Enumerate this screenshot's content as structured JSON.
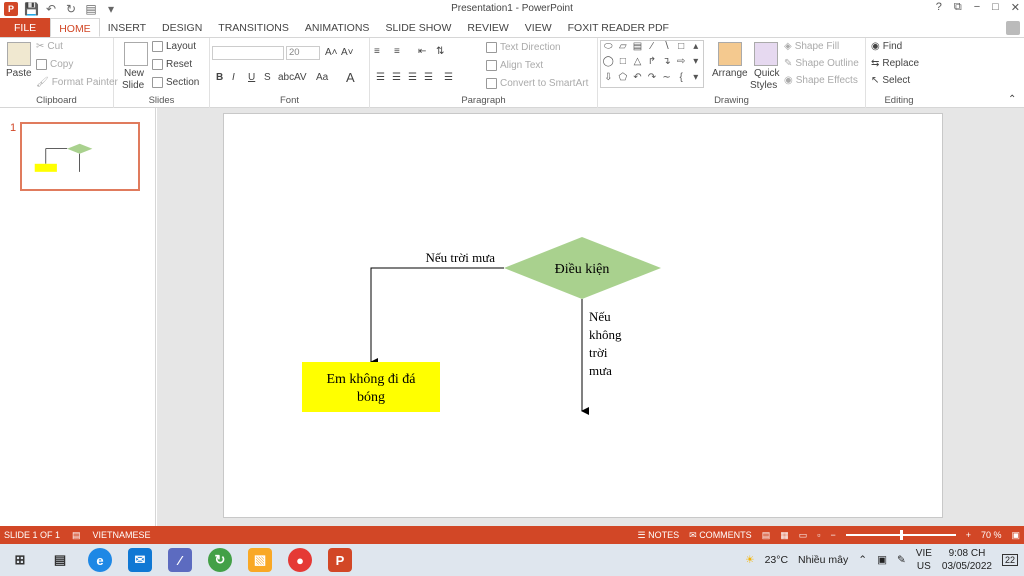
{
  "window": {
    "title": "Presentation1 - PowerPoint",
    "controls": [
      "?",
      "⧉",
      "−",
      "□",
      "✕"
    ]
  },
  "qat": {
    "logo": "P"
  },
  "tabs": [
    "FILE",
    "HOME",
    "INSERT",
    "DESIGN",
    "TRANSITIONS",
    "ANIMATIONS",
    "SLIDE SHOW",
    "REVIEW",
    "VIEW",
    "FOXIT READER PDF"
  ],
  "active_tab": "HOME",
  "ribbon": {
    "clipboard": {
      "label": "Clipboard",
      "paste": "Paste",
      "cut": "Cut",
      "copy": "Copy",
      "format_painter": "Format Painter"
    },
    "slides": {
      "label": "Slides",
      "new_slide_1": "New",
      "new_slide_2": "Slide",
      "layout": "Layout",
      "reset": "Reset",
      "section": "Section"
    },
    "font": {
      "label": "Font",
      "font_size": "20",
      "bold": "B",
      "italic": "I",
      "underline": "U",
      "strike": "S",
      "shadow": "abc",
      "spacing": "AV",
      "case": "Aa",
      "grow": "A˄",
      "shrink": "A˅",
      "color": "A"
    },
    "paragraph": {
      "label": "Paragraph",
      "text_direction": "Text Direction",
      "align_text": "Align Text",
      "smartart": "Convert to SmartArt"
    },
    "drawing": {
      "label": "Drawing",
      "arrange": "Arrange",
      "quick_styles_1": "Quick",
      "quick_styles_2": "Styles",
      "shape_fill": "Shape Fill",
      "shape_outline": "Shape Outline",
      "shape_effects": "Shape Effects"
    },
    "editing": {
      "label": "Editing",
      "find": "Find",
      "replace": "Replace",
      "select": "Select"
    }
  },
  "thumbnail": {
    "number": "1"
  },
  "slide": {
    "diamond_text": "Điều kiện",
    "left_branch_label": "Nếu trời mưa",
    "down_branch_label": [
      "Nếu",
      "không",
      "trời",
      "mưa"
    ],
    "box_text": [
      "Em không đi đá",
      "bóng"
    ],
    "diamond_color": "#a9d18e",
    "box_color": "#ffff00"
  },
  "status": {
    "slide_of": "SLIDE 1 OF 1",
    "language": "VIETNAMESE",
    "notes": "NOTES",
    "comments": "COMMENTS",
    "zoom": "70 %",
    "zoom_level": 0.7
  },
  "taskbar": {
    "weather_temp": "23°C",
    "weather_desc": "Nhiều mây",
    "lang_1": "VIE",
    "lang_2": "US",
    "time": "9:08 CH",
    "date": "03/05/2022",
    "notif_count": "22"
  }
}
